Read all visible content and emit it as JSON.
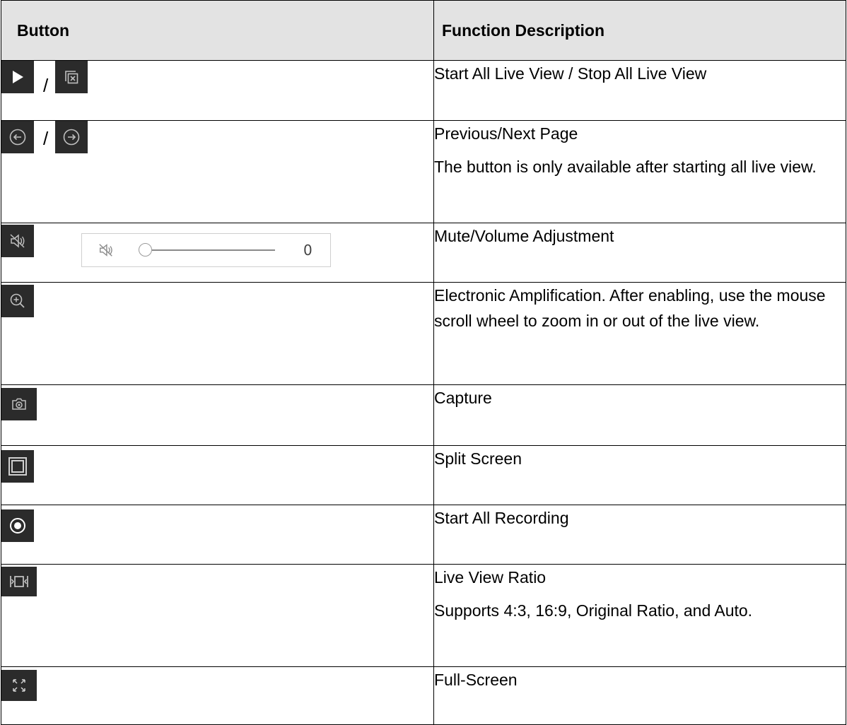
{
  "table": {
    "headers": {
      "button": "Button",
      "function": "Function Description"
    },
    "rows": [
      {
        "desc": [
          "Start All Live View / Stop All Live View"
        ],
        "icons": [
          "play-icon",
          "stop-all-icon"
        ]
      },
      {
        "desc": [
          "Previous/Next Page",
          "The button is only available after starting all live view."
        ],
        "icons": [
          "previous-page-icon",
          "next-page-icon"
        ]
      },
      {
        "desc": [
          "Mute/Volume Adjustment"
        ],
        "icons": [
          "mute-icon",
          "volume-slider"
        ]
      },
      {
        "desc": [
          "Electronic Amplification. After enabling, use the mouse scroll wheel to zoom in or out of the live view."
        ],
        "icons": [
          "zoom-in-icon"
        ]
      },
      {
        "desc": [
          "Capture"
        ],
        "icons": [
          "camera-icon"
        ]
      },
      {
        "desc": [
          "Split Screen"
        ],
        "icons": [
          "split-screen-icon"
        ]
      },
      {
        "desc": [
          "Start All Recording"
        ],
        "icons": [
          "record-icon"
        ]
      },
      {
        "desc": [
          "Live View Ratio",
          "Supports 4:3, 16:9, Original Ratio, and Auto."
        ],
        "icons": [
          "ratio-icon"
        ]
      },
      {
        "desc": [
          "Full-Screen"
        ],
        "icons": [
          "fullscreen-icon"
        ]
      }
    ],
    "separator": "/",
    "volume": {
      "value": 0,
      "value_label": "0"
    }
  }
}
